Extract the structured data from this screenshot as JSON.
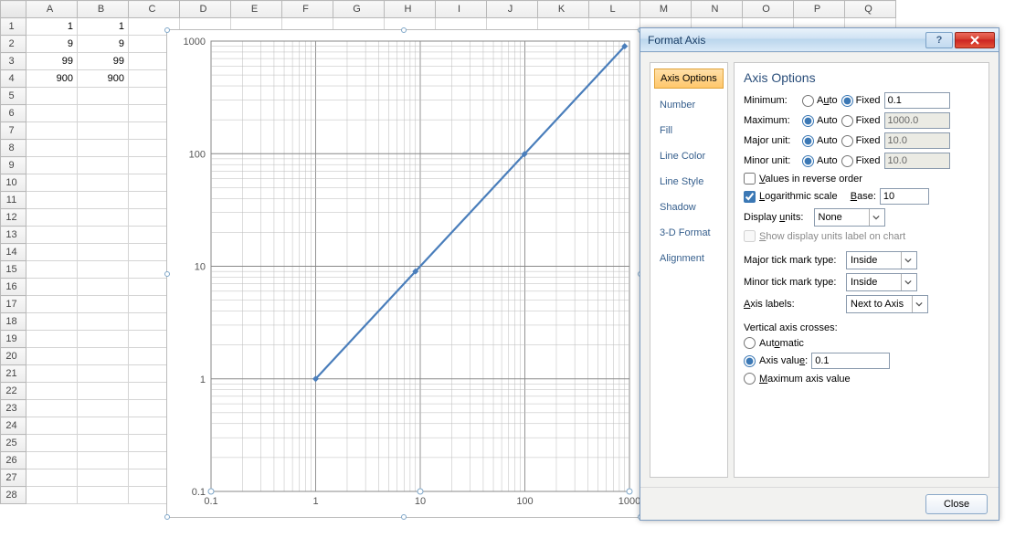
{
  "columns": [
    "A",
    "B",
    "C",
    "D",
    "E",
    "F",
    "G",
    "H",
    "I",
    "J",
    "K",
    "L",
    "M",
    "N",
    "O",
    "P",
    "Q"
  ],
  "rows_count": 28,
  "cells": {
    "A1": "1",
    "B1": "1",
    "A2": "9",
    "B2": "9",
    "A3": "99",
    "B3": "99",
    "A4": "900",
    "B4": "900"
  },
  "chart_data": {
    "type": "line",
    "x": [
      1,
      9,
      99,
      900
    ],
    "y": [
      1,
      9,
      99,
      900
    ],
    "xscale": "log",
    "yscale": "log",
    "xlim": [
      0.1,
      1000
    ],
    "ylim": [
      0.1,
      1000
    ],
    "xticks": [
      0.1,
      1,
      10,
      100,
      1000
    ],
    "yticks": [
      0.1,
      1,
      10,
      100,
      1000
    ],
    "xticklabels": [
      "0.1",
      "1",
      "10",
      "100",
      "1000"
    ],
    "yticklabels": [
      "0.1",
      "1",
      "10",
      "100",
      "1000"
    ],
    "title": "",
    "xlabel": "",
    "ylabel": ""
  },
  "dialog": {
    "title": "Format Axis",
    "nav": [
      "Axis Options",
      "Number",
      "Fill",
      "Line Color",
      "Line Style",
      "Shadow",
      "3-D Format",
      "Alignment"
    ],
    "heading": "Axis Options",
    "min_label": "Minimum:",
    "auto_label": "Auto",
    "fixed_label": "Fixed",
    "min_value": "0.1",
    "max_label": "Maximum:",
    "max_value": "1000.0",
    "major_label": "Major unit:",
    "major_value": "10.0",
    "minor_label": "Minor unit:",
    "minor_value": "10.0",
    "reverse_label": "Values in reverse order",
    "log_label": "Logarithmic scale",
    "base_label": "Base:",
    "base_value": "10",
    "display_units_label": "Display units:",
    "display_units_value": "None",
    "show_units_label": "Show display units label on chart",
    "major_tick_label": "Major tick mark type:",
    "major_tick_value": "Inside",
    "minor_tick_label": "Minor tick mark type:",
    "minor_tick_value": "Inside",
    "axis_labels_label": "Axis labels:",
    "axis_labels_value": "Next to Axis",
    "crosses_heading": "Vertical axis crosses:",
    "crosses_auto": "Automatic",
    "crosses_value_label": "Axis value:",
    "crosses_value": "0.1",
    "crosses_max": "Maximum axis value",
    "close_btn": "Close",
    "help_glyph": "?"
  }
}
